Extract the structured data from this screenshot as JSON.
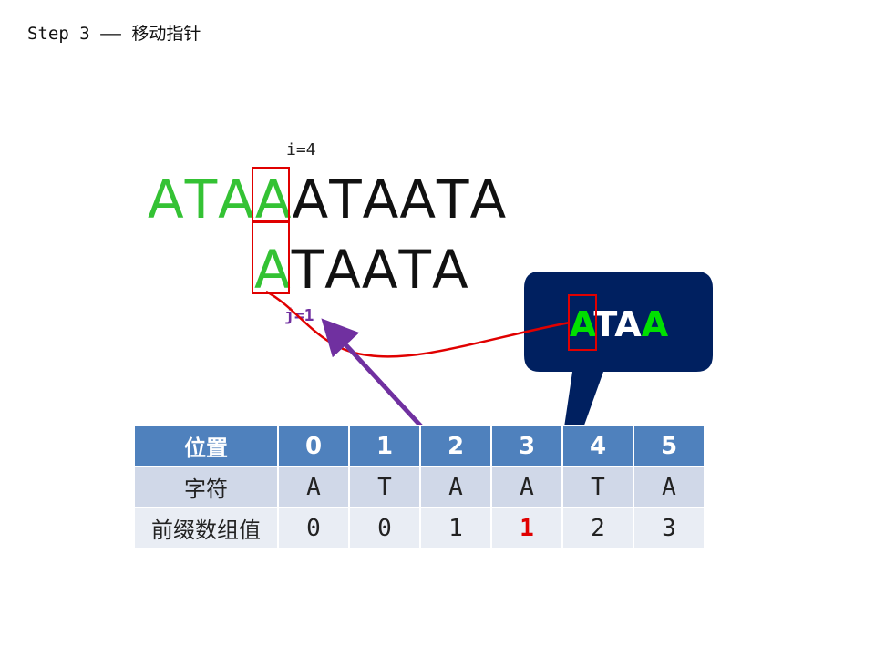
{
  "title": "Step 3 —— 移动指针",
  "text_sequence": [
    "A",
    "T",
    "A",
    "A",
    "A",
    "T",
    "A",
    "A",
    "T",
    "A"
  ],
  "text_highlight_count": 4,
  "pattern_sequence": [
    "A",
    "T",
    "A",
    "A",
    "T",
    "A"
  ],
  "pattern_highlight_count": 1,
  "i_label": "i=4",
  "j_label": "j=1",
  "callout_chars": [
    "A",
    "T",
    "A",
    "A"
  ],
  "callout_green": [
    true,
    false,
    false,
    true
  ],
  "table": {
    "headers": [
      "位置",
      "0",
      "1",
      "2",
      "3",
      "4",
      "5"
    ],
    "rows": [
      [
        "字符",
        "A",
        "T",
        "A",
        "A",
        "T",
        "A"
      ],
      [
        "前缀数组值",
        "0",
        "0",
        "1",
        "1",
        "2",
        "3"
      ]
    ],
    "highlight_cell": {
      "row": 1,
      "col": 4
    }
  },
  "colors": {
    "match_green": "#34c234",
    "highlight_red": "#e00000",
    "arrow_purple": "#7030a0",
    "callout_navy": "#002060",
    "table_header": "#4f81bd"
  }
}
